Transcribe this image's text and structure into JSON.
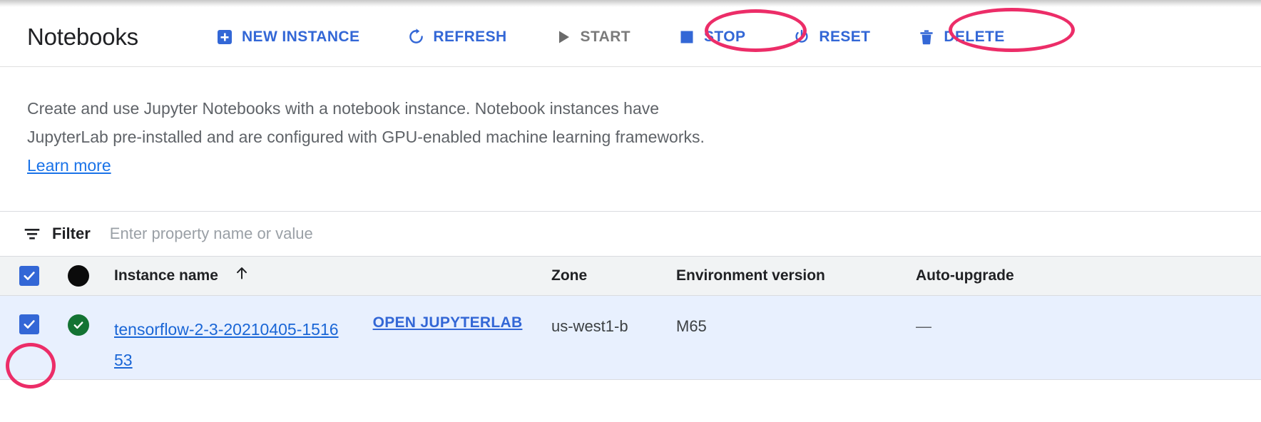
{
  "header": {
    "title": "Notebooks",
    "toolbar": [
      {
        "label": "NEW INSTANCE",
        "icon": "add-box-icon",
        "state": "enabled",
        "highlighted": false
      },
      {
        "label": "REFRESH",
        "icon": "refresh-icon",
        "state": "enabled",
        "highlighted": false
      },
      {
        "label": "START",
        "icon": "play-icon",
        "state": "disabled",
        "highlighted": false
      },
      {
        "label": "STOP",
        "icon": "stop-square-icon",
        "state": "enabled",
        "highlighted": true
      },
      {
        "label": "RESET",
        "icon": "power-icon",
        "state": "enabled",
        "highlighted": false
      },
      {
        "label": "DELETE",
        "icon": "trash-icon",
        "state": "enabled",
        "highlighted": true
      }
    ]
  },
  "description": {
    "text": "Create and use Jupyter Notebooks with a notebook instance. Notebook instances have JupyterLab pre-installed and are configured with GPU-enabled machine learning frameworks.",
    "link_label": "Learn more"
  },
  "filter": {
    "icon": "filter-list-icon",
    "label": "Filter",
    "value": "",
    "placeholder": "Enter property name or value"
  },
  "table": {
    "columns": [
      {
        "key": "select",
        "label": ""
      },
      {
        "key": "status",
        "label": ""
      },
      {
        "key": "name",
        "label": "Instance name",
        "sort": "ascending",
        "sort_icon": "arrow-up-icon"
      },
      {
        "key": "open",
        "label": ""
      },
      {
        "key": "zone",
        "label": "Zone"
      },
      {
        "key": "env",
        "label": "Environment version"
      },
      {
        "key": "autoupgrade",
        "label": "Auto-upgrade"
      }
    ],
    "header_select_all": {
      "checked": true,
      "icon": "checkbox-checked-icon"
    },
    "header_status_icon": "filled-circle-icon",
    "rows": [
      {
        "selected": true,
        "checkbox_icon": "checkbox-checked-icon",
        "checkbox_highlighted": true,
        "status_icon": "check-circle-icon",
        "status_color": "#137333",
        "name": "tensorflow-2-3-20210405-151653",
        "open_label": "OPEN JUPYTERLAB",
        "zone": "us-west1-b",
        "env": "M65",
        "autoupgrade": "—"
      }
    ]
  },
  "colors": {
    "accent_blue": "#3367d6",
    "link_blue": "#1a73e8",
    "highlight_pink": "#ec2d68",
    "selected_row": "#e8f0fe",
    "header_band": "#f1f3f4",
    "disabled_gray": "#7b7b7b",
    "status_green": "#137333"
  }
}
